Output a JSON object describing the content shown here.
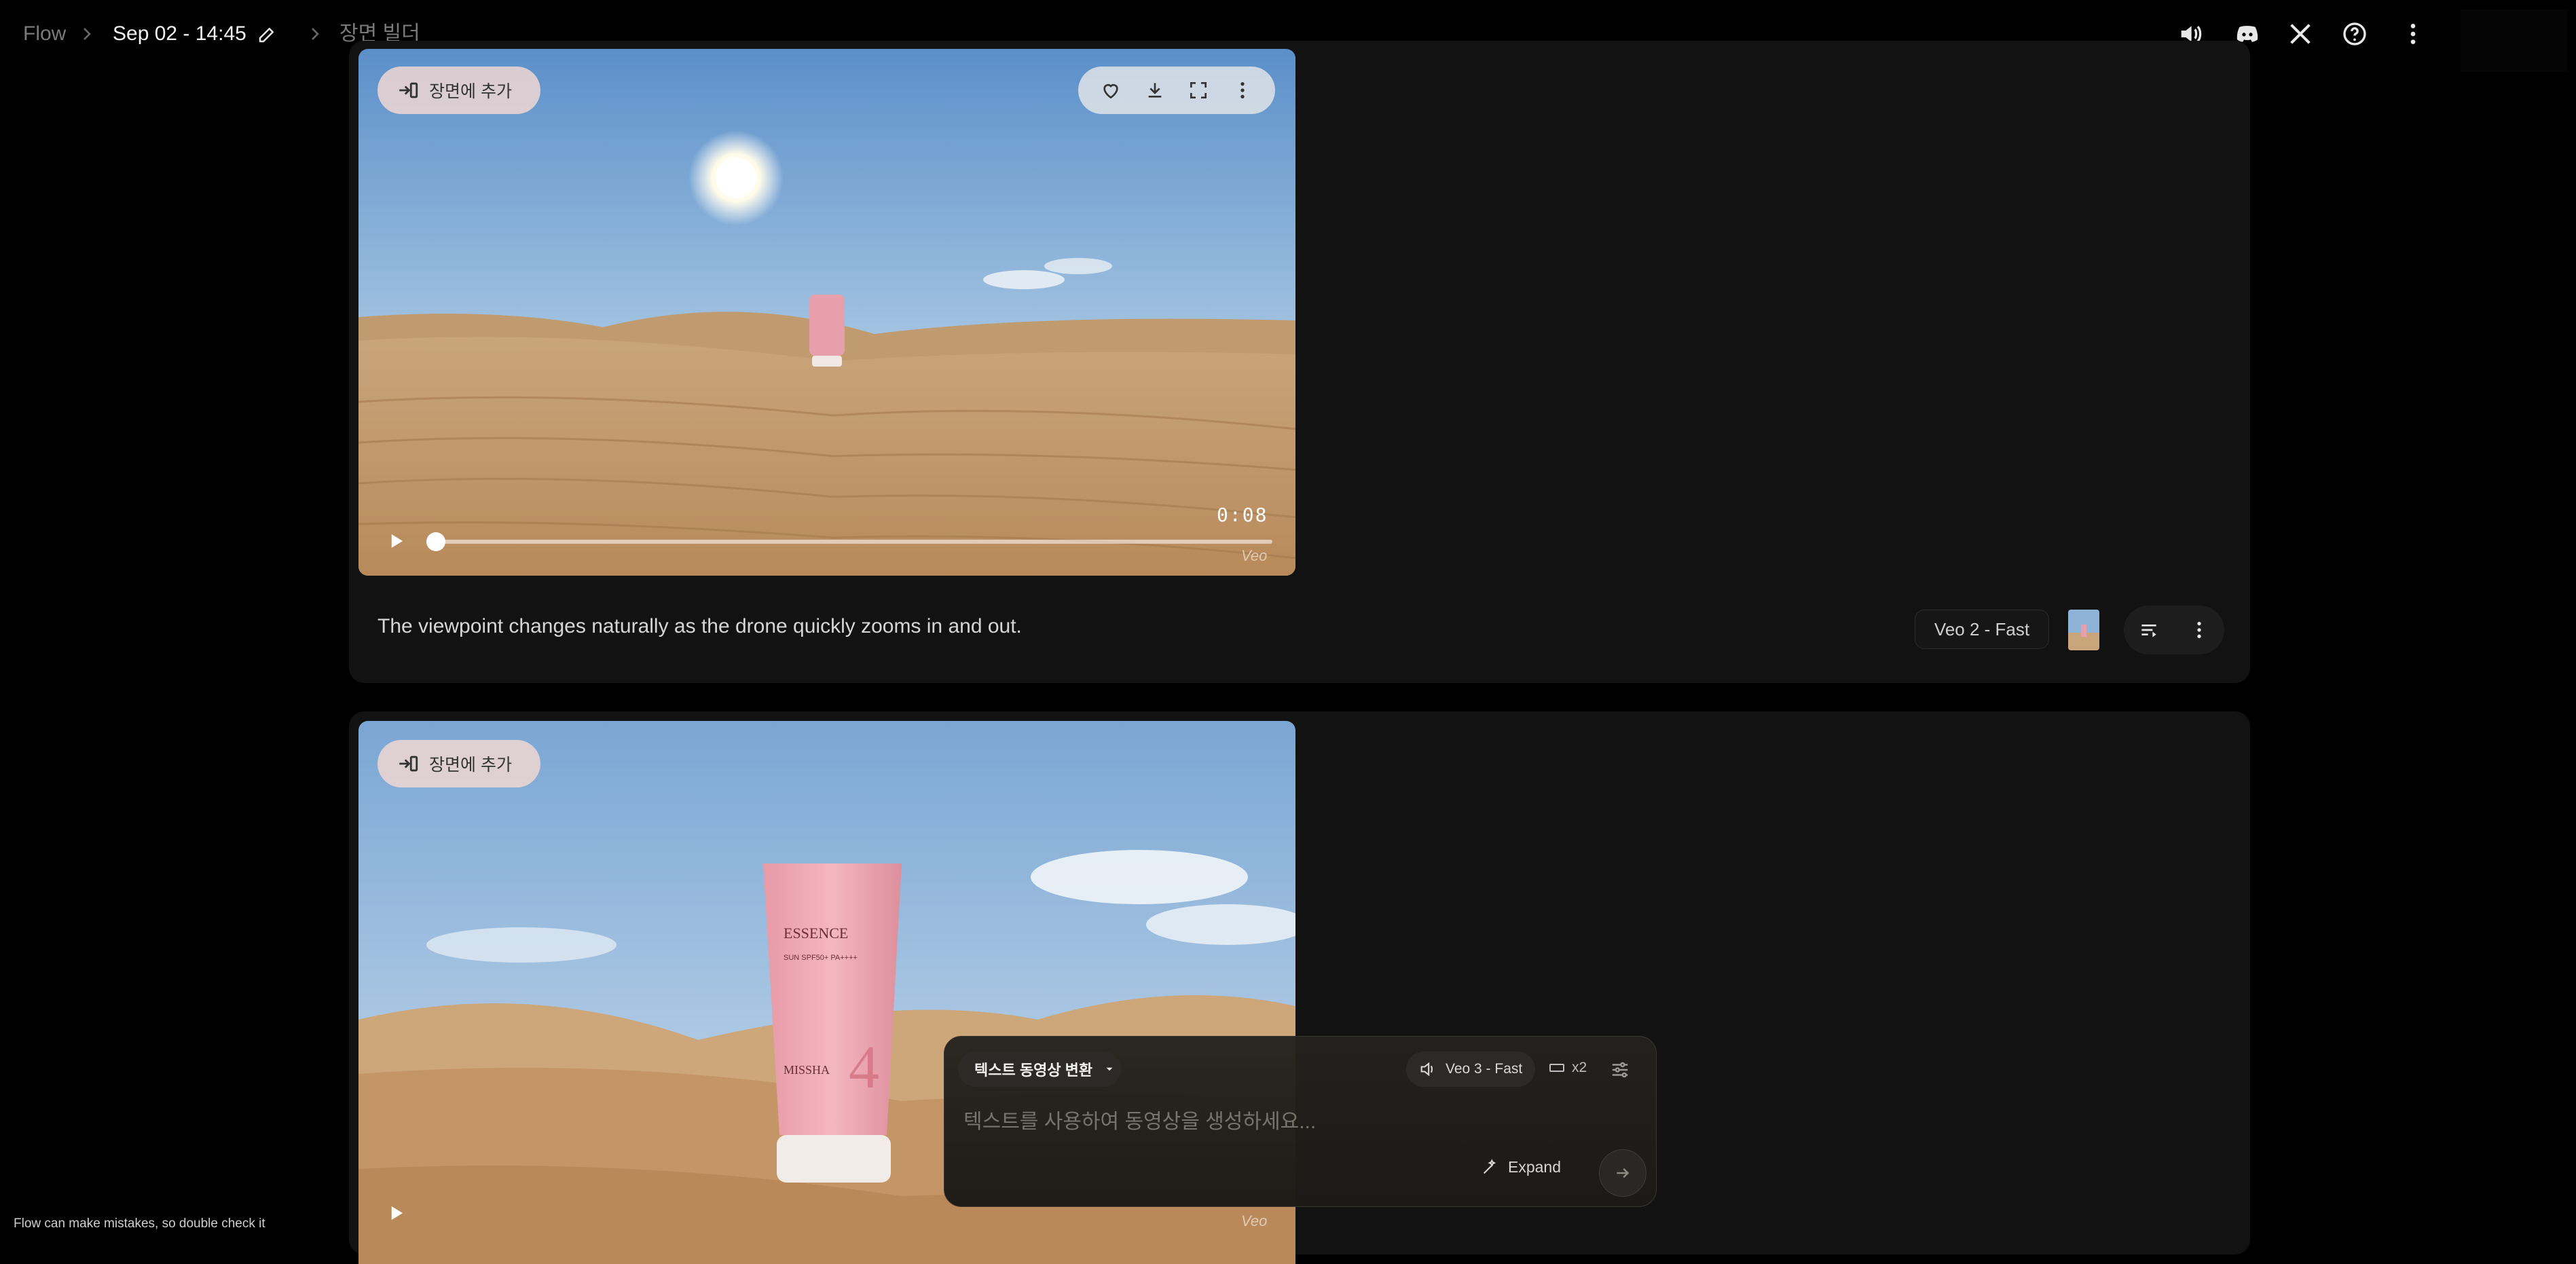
{
  "breadcrumb": {
    "root": "Flow",
    "project": "Sep 02 - 14:45",
    "section": "장면 빌더"
  },
  "top_icons": [
    "volume-icon",
    "discord-icon",
    "x-icon",
    "help-icon",
    "more-vert-icon"
  ],
  "clips": [
    {
      "add_scene_label": "장면에 추가",
      "timecode": "0:08",
      "watermark": "Veo",
      "caption": "The viewpoint changes naturally as the drone quickly zooms in and out.",
      "model": "Veo 2 - Fast",
      "toolbar_icons": [
        "favorite-icon",
        "download-icon",
        "fullscreen-icon",
        "more-vert-icon"
      ],
      "progress": 0
    },
    {
      "add_scene_label": "장면에 추가",
      "watermark": "Veo",
      "product_text": {
        "brand": "ESSENCE",
        "line": "SUN SPF50+ PA++++",
        "maker": "MISSHA",
        "number": "4"
      }
    }
  ],
  "composer": {
    "mode": "텍스트 동영상 변환",
    "placeholder": "텍스트를 사용하여 동영상을 생성하세요...",
    "model": "Veo 3 - Fast",
    "count": "x2",
    "expand_label": "Expand"
  },
  "footer_note": "Flow can make mistakes, so double check it",
  "colors": {
    "background": "#000000",
    "card": "#121212",
    "pill": "#f0d7d2",
    "composer": "#24221e"
  }
}
